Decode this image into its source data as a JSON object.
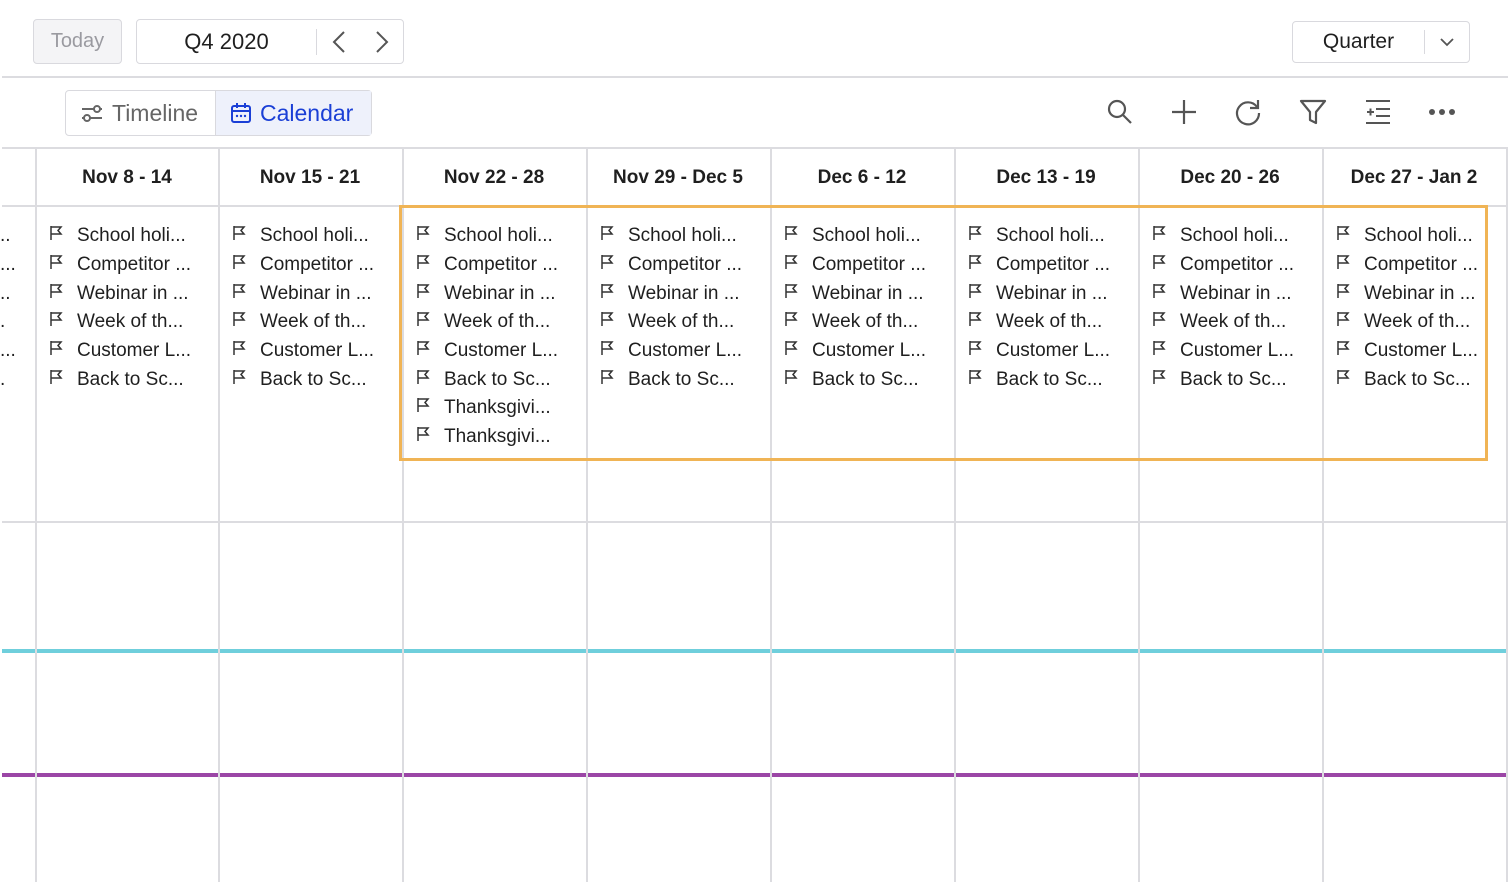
{
  "toolbar": {
    "today": "Today",
    "period": "Q4 2020",
    "scale": "Quarter"
  },
  "views": {
    "timeline": "Timeline",
    "calendar": "Calendar",
    "active": "Calendar"
  },
  "tools": [
    "search-icon",
    "plus-icon",
    "refresh-icon",
    "filter-icon",
    "add-list-icon",
    "more-icon"
  ],
  "colors": {
    "highlight": "#f0b455",
    "accent": "#1a3fd6",
    "cyan_line": "#6fcfdc",
    "purple_line": "#9b46a6"
  },
  "partial_column_items": [
    "..",
    "...",
    "..",
    ".",
    "...",
    "."
  ],
  "columns": [
    {
      "label": "Nov 8 - 14",
      "items": [
        "School holi...",
        "Competitor ...",
        "Webinar in ...",
        "Week of th...",
        "Customer L...",
        "Back to Sc..."
      ]
    },
    {
      "label": "Nov 15 - 21",
      "items": [
        "School holi...",
        "Competitor ...",
        "Webinar in ...",
        "Week of th...",
        "Customer L...",
        "Back to Sc..."
      ]
    },
    {
      "label": "Nov 22 - 28",
      "items": [
        "School holi...",
        "Competitor ...",
        "Webinar in ...",
        "Week of th...",
        "Customer L...",
        "Back to Sc...",
        "Thanksgivi...",
        "Thanksgivi..."
      ]
    },
    {
      "label": "Nov 29 - Dec 5",
      "items": [
        "School holi...",
        "Competitor ...",
        "Webinar in ...",
        "Week of th...",
        "Customer L...",
        "Back to Sc..."
      ]
    },
    {
      "label": "Dec 6 - 12",
      "items": [
        "School holi...",
        "Competitor ...",
        "Webinar in ...",
        "Week of th...",
        "Customer L...",
        "Back to Sc..."
      ]
    },
    {
      "label": "Dec 13 - 19",
      "items": [
        "School holi...",
        "Competitor ...",
        "Webinar in ...",
        "Week of th...",
        "Customer L...",
        "Back to Sc..."
      ]
    },
    {
      "label": "Dec 20 - 26",
      "items": [
        "School holi...",
        "Competitor ...",
        "Webinar in ...",
        "Week of th...",
        "Customer L...",
        "Back to Sc..."
      ]
    },
    {
      "label": "Dec 27 - Jan 2",
      "items": [
        "School holi...",
        "Competitor ...",
        "Webinar in ...",
        "Week of th...",
        "Customer L...",
        "Back to Sc..."
      ]
    }
  ]
}
